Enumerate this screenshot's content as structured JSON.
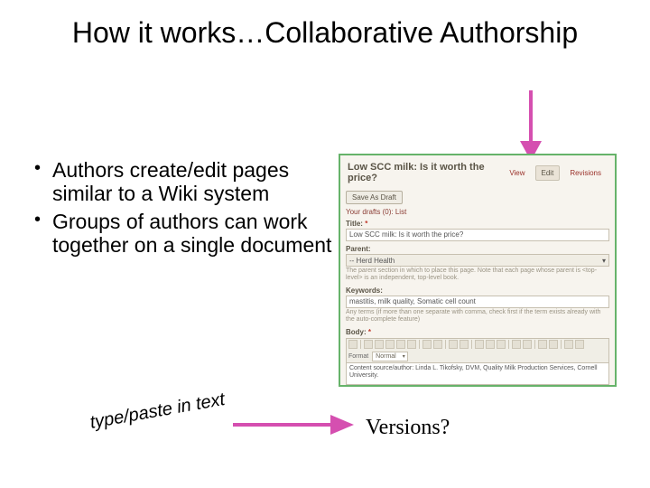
{
  "title": "How it works…Collaborative Authorship",
  "bullets": [
    "Authors create/edit pages similar to a Wiki system",
    "Groups of authors can work together on a single document"
  ],
  "annotation_left": "type/paste in text",
  "annotation_right": "Versions?",
  "panel": {
    "heading": "Low SCC milk: Is it worth the price?",
    "tabs": {
      "view": "View",
      "edit": "Edit",
      "revisions": "Revisions"
    },
    "save_draft": "Save As Draft",
    "drafts_link": "Your drafts (0): List",
    "title_label": "Title:",
    "title_value": "Low SCC milk: Is it worth the price?",
    "parent_label": "Parent:",
    "parent_value": "-- Herd Health",
    "parent_help": "The parent section in which to place this page. Note that each page whose parent is <top-level> is an independent, top-level book.",
    "keywords_label": "Keywords:",
    "keywords_value": "mastitis, milk quality, Somatic cell count",
    "keywords_help": "Any terms (if more than one separate with comma, check first if the term exists already with the auto-complete feature)",
    "body_label": "Body:",
    "format_label": "Format",
    "format_value": "Normal",
    "body_text": "Content source/author:  Linda L. Tikofsky, DVM, Quality Milk Production Services, Cornell University."
  },
  "colors": {
    "arrow": "#d54fb0",
    "panel_border": "#66b36a"
  }
}
